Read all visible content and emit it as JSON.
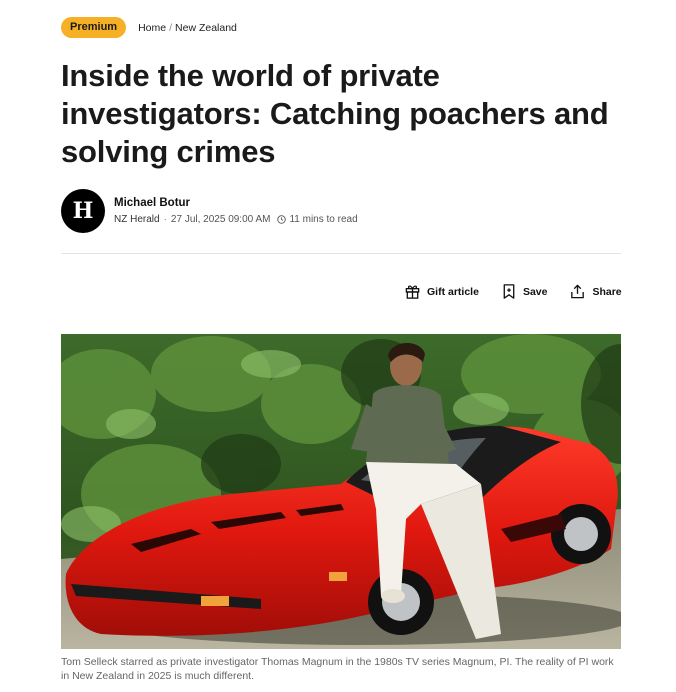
{
  "badge": "Premium",
  "breadcrumb": {
    "home": "Home",
    "separator": "/",
    "section": "New Zealand"
  },
  "headline": "Inside the world of private investigators: Catching poachers and solving crimes",
  "byline": {
    "logo_letter": "H",
    "author": "Michael Botur",
    "publication": "NZ Herald",
    "separator": "·",
    "date": "27 Jul, 2025 09:00 AM",
    "read_time": "11 mins to read"
  },
  "actions": {
    "gift": "Gift article",
    "save": "Save",
    "share": "Share"
  },
  "image": {
    "caption": "Tom Selleck starred as private investigator Thomas Magnum in the 1980s TV series Magnum, PI. The reality of PI work in New Zealand in 2025 is much different."
  },
  "colors": {
    "badge": "#f5b026",
    "text": "#111111",
    "caption": "#666666",
    "divider": "#e3e3e3"
  },
  "icons": [
    "gift-icon",
    "bookmark-icon",
    "share-icon",
    "clock-icon"
  ]
}
